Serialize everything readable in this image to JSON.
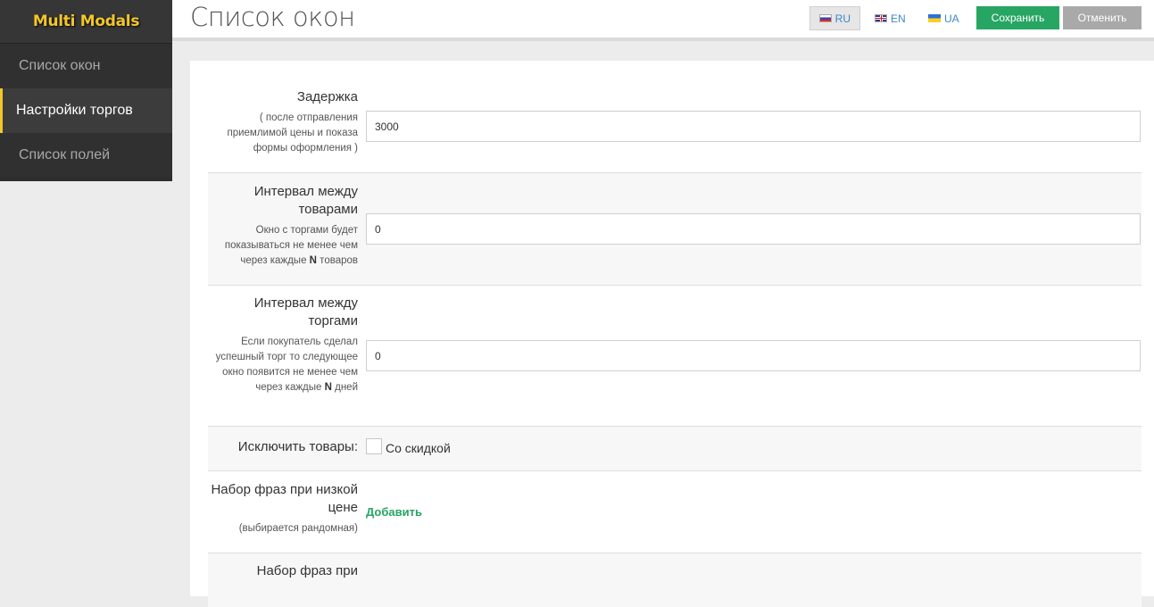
{
  "app": {
    "brand": "Multi Modals"
  },
  "sidebar": {
    "items": [
      {
        "label": "Список окон"
      },
      {
        "label": "Настройки торгов"
      },
      {
        "label": "Список полей"
      }
    ]
  },
  "header": {
    "title": "Список окон",
    "languages": [
      {
        "code": "RU",
        "flag": "flag-ru-icon"
      },
      {
        "code": "EN",
        "flag": "flag-en-icon"
      },
      {
        "code": "UA",
        "flag": "flag-ua-icon"
      }
    ],
    "save_label": "Сохранить",
    "cancel_label": "Отменить",
    "colors": {
      "save": "#27a663",
      "cancel": "#a9a9a9",
      "brand": "#f2c72a"
    }
  },
  "form": {
    "delay": {
      "label": "Задержка",
      "hint": "( после отправления приемлимой цены и показа формы оформления )",
      "value": "3000"
    },
    "product_interval": {
      "label": "Интервал между товарами",
      "hint_pre": "Окно с торгами будет показываться не менее чем через каждые ",
      "hint_bold": "N",
      "hint_post": " товаров",
      "value": "0"
    },
    "trade_interval": {
      "label": "Интервал между торгами",
      "hint_pre": "Если покупатель сделал успешный торг то следующее окно появится не менее чем через каждые ",
      "hint_bold": "N",
      "hint_post": " дней",
      "value": "0"
    },
    "exclude": {
      "label": "Исключить товары:",
      "option": "Со скидкой"
    },
    "low_price_phrases": {
      "label": "Набор фраз при низкой цене",
      "hint": "(выбирается рандомная)",
      "add_label": "Добавить"
    },
    "next_section": {
      "label": "Набор фраз при"
    }
  }
}
